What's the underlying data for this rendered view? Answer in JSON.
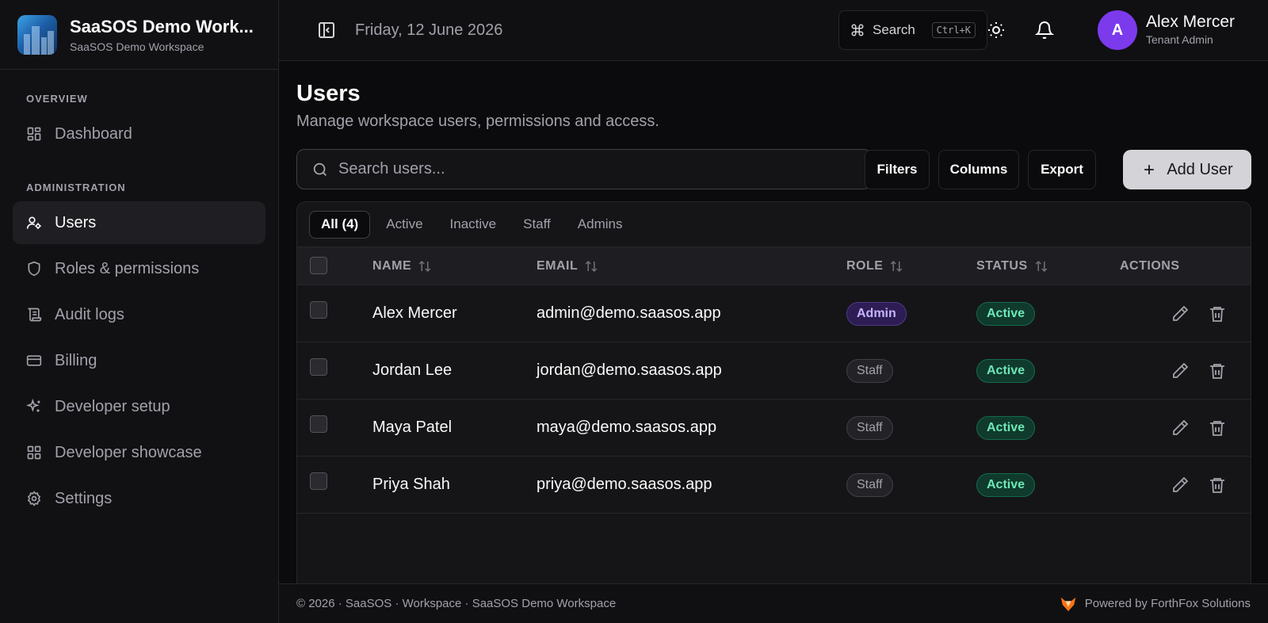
{
  "brand": {
    "title": "SaaSOS Demo Work...",
    "subtitle": "SaaSOS Demo Workspace"
  },
  "sidebar": {
    "sections": [
      {
        "label": "OVERVIEW",
        "items": [
          {
            "label": "Dashboard",
            "icon": "dashboard-icon"
          }
        ]
      },
      {
        "label": "ADMINISTRATION",
        "items": [
          {
            "label": "Users",
            "icon": "user-gear-icon",
            "active": true
          },
          {
            "label": "Roles & permissions",
            "icon": "shield-icon"
          },
          {
            "label": "Audit logs",
            "icon": "scroll-icon"
          },
          {
            "label": "Billing",
            "icon": "credit-card-icon"
          },
          {
            "label": "Developer setup",
            "icon": "sparkles-icon"
          },
          {
            "label": "Developer showcase",
            "icon": "grid-icon"
          },
          {
            "label": "Settings",
            "icon": "gear-icon"
          }
        ]
      }
    ]
  },
  "header": {
    "date": "Friday, 12 June 2026",
    "search_label": "Search",
    "search_shortcut": "Ctrl+K",
    "user": {
      "initial": "A",
      "name": "Alex Mercer",
      "role": "Tenant Admin"
    }
  },
  "main": {
    "title": "Users",
    "subtitle": "Manage workspace users, permissions and access.",
    "search_placeholder": "Search users...",
    "buttons": {
      "filters": "Filters",
      "columns": "Columns",
      "export": "Export",
      "add_user": "Add User"
    },
    "tabs": [
      "All (4)",
      "Active",
      "Inactive",
      "Staff",
      "Admins"
    ],
    "columns": {
      "name": "NAME",
      "email": "EMAIL",
      "role": "ROLE",
      "status": "STATUS",
      "actions": "ACTIONS"
    },
    "rows": [
      {
        "name": "Alex Mercer",
        "email": "admin@demo.saasos.app",
        "role": "Admin",
        "status": "Active"
      },
      {
        "name": "Jordan Lee",
        "email": "jordan@demo.saasos.app",
        "role": "Staff",
        "status": "Active"
      },
      {
        "name": "Maya Patel",
        "email": "maya@demo.saasos.app",
        "role": "Staff",
        "status": "Active"
      },
      {
        "name": "Priya Shah",
        "email": "priya@demo.saasos.app",
        "role": "Staff",
        "status": "Active"
      }
    ]
  },
  "footer": {
    "left": "© 2026 · SaaSOS · Workspace · SaaSOS Demo Workspace",
    "powered": "Powered by ForthFox Solutions"
  },
  "colors": {
    "accent": "#7c3aed",
    "active_badge": "#6ee7b7",
    "admin_badge": "#c4b5fd"
  }
}
